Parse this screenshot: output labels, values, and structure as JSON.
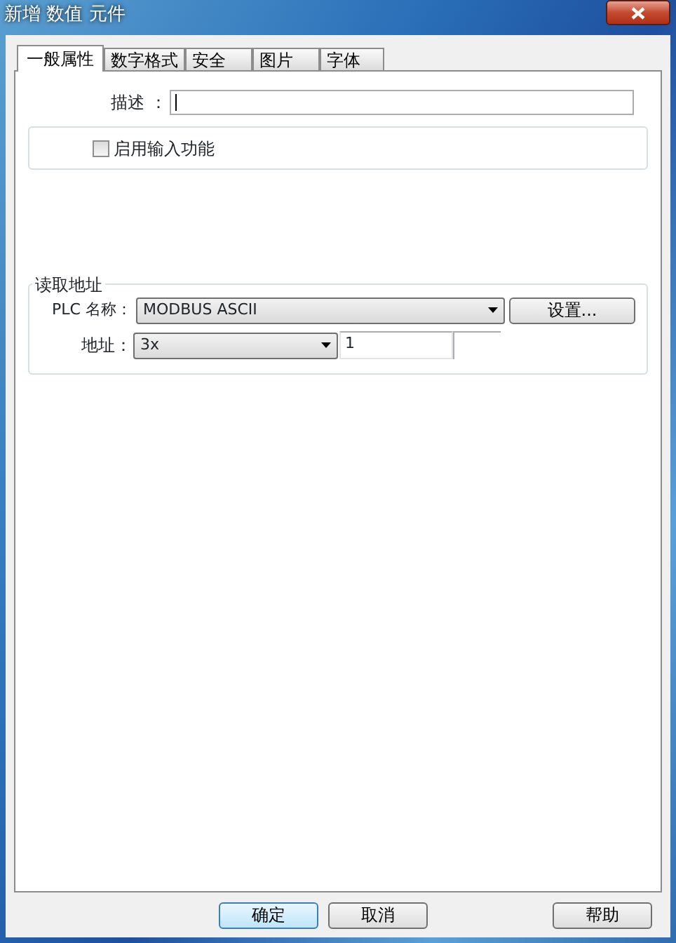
{
  "window": {
    "title": "新增 数值 元件"
  },
  "tabs": [
    {
      "label": "一般属性",
      "selected": true
    },
    {
      "label": "数字格式",
      "selected": false
    },
    {
      "label": "安全",
      "selected": false
    },
    {
      "label": "图片",
      "selected": false
    },
    {
      "label": "字体",
      "selected": false
    }
  ],
  "description": {
    "label": "描述 ："
  },
  "input_enable": {
    "label": "启用输入功能",
    "checked": false
  },
  "read_address": {
    "title": "读取地址",
    "plc_label": "PLC 名称：",
    "plc_name": "MODBUS ASCII",
    "settings_button": "设置...",
    "address_label": "地址：",
    "address_type": "3x",
    "address_value": "1"
  },
  "buttons": [
    {
      "label": "确定",
      "default": true
    },
    {
      "label": "取消",
      "default": false
    },
    {
      "label": "帮助",
      "default": false
    }
  ]
}
